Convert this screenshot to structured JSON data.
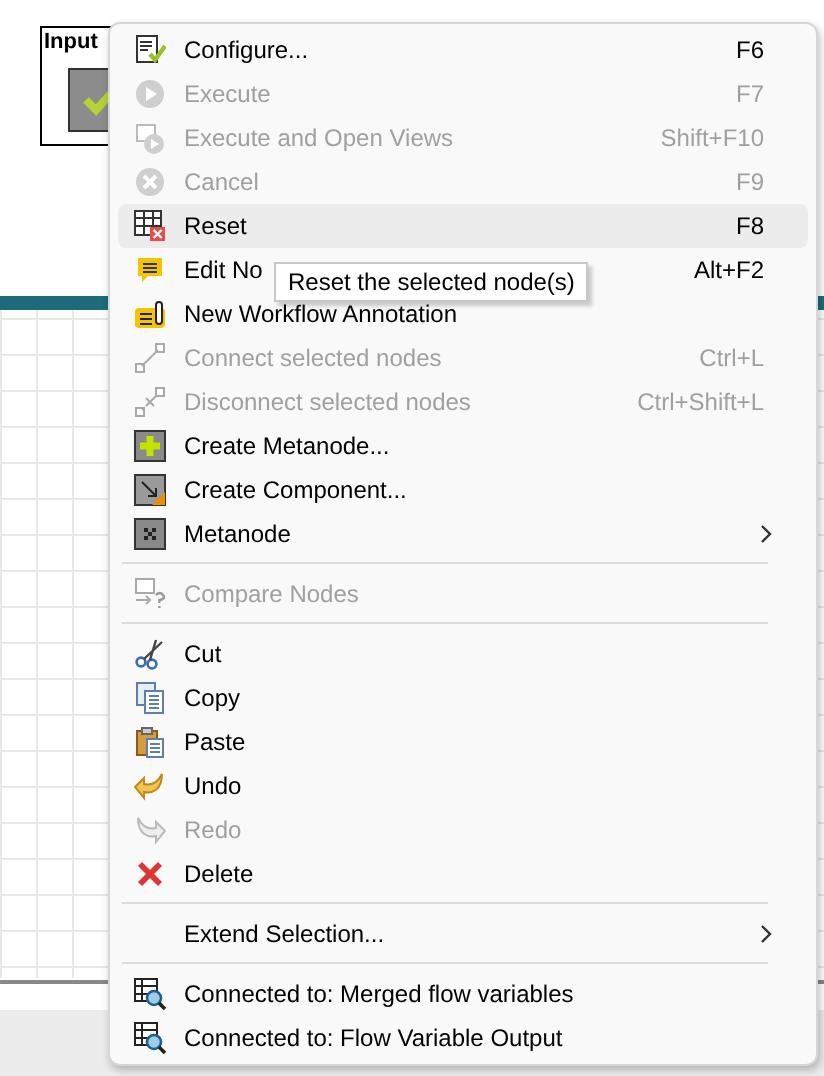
{
  "node": {
    "label": "Input",
    "executed": true
  },
  "context_menu": {
    "sections": [
      {
        "items": [
          {
            "label": "Configure...",
            "shortcut": "F6",
            "disabled": false,
            "selected": false
          },
          {
            "label": "Execute",
            "shortcut": "F7",
            "disabled": true,
            "selected": false
          },
          {
            "label": "Execute and Open Views",
            "shortcut": "Shift+F10",
            "disabled": true,
            "selected": false
          },
          {
            "label": "Cancel",
            "shortcut": "F9",
            "disabled": true,
            "selected": false
          },
          {
            "label": "Reset",
            "shortcut": "F8",
            "disabled": false,
            "selected": true
          },
          {
            "label": "Edit No",
            "shortcut": "Alt+F2",
            "disabled": false,
            "selected": false
          },
          {
            "label": "New Workflow Annotation",
            "disabled": false,
            "selected": false
          },
          {
            "label": "Connect selected nodes",
            "shortcut": "Ctrl+L",
            "disabled": true,
            "selected": false
          },
          {
            "label": "Disconnect selected nodes",
            "shortcut": "Ctrl+Shift+L",
            "disabled": true,
            "selected": false
          },
          {
            "label": "Create Metanode...",
            "disabled": false,
            "selected": false
          },
          {
            "label": "Create Component...",
            "disabled": false,
            "selected": false
          },
          {
            "label": "Metanode",
            "disabled": false,
            "selected": false,
            "submenu": true
          }
        ]
      },
      {
        "items": [
          {
            "label": "Compare Nodes",
            "disabled": true,
            "selected": false
          }
        ]
      },
      {
        "items": [
          {
            "label": "Cut",
            "disabled": false,
            "selected": false
          },
          {
            "label": "Copy",
            "disabled": false,
            "selected": false
          },
          {
            "label": "Paste",
            "disabled": false,
            "selected": false
          },
          {
            "label": "Undo",
            "disabled": false,
            "selected": false
          },
          {
            "label": "Redo",
            "disabled": true,
            "selected": false
          },
          {
            "label": "Delete",
            "disabled": false,
            "selected": false
          }
        ]
      },
      {
        "items": [
          {
            "label": "Extend Selection...",
            "disabled": false,
            "selected": false,
            "submenu": true
          }
        ]
      },
      {
        "items": [
          {
            "label": "Connected to: Merged flow variables",
            "disabled": false,
            "selected": false
          },
          {
            "label": "Connected to: Flow Variable Output",
            "disabled": false,
            "selected": false
          }
        ]
      }
    ]
  },
  "tooltip": {
    "text": "Reset the selected node(s)"
  }
}
